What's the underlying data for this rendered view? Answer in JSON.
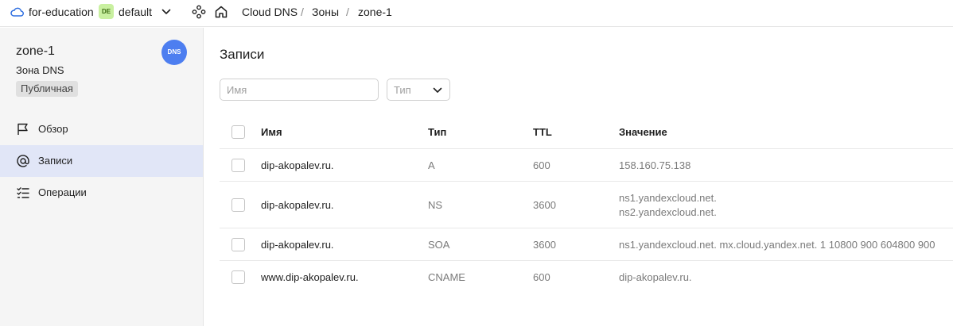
{
  "topbar": {
    "org": "for-education",
    "folder_badge": "DE",
    "folder": "default",
    "breadcrumbs": [
      "Cloud DNS",
      "Зоны",
      "zone-1"
    ],
    "separator": "/"
  },
  "sidebar": {
    "title": "zone-1",
    "subtitle": "Зона DNS",
    "badge": "Публичная",
    "avatar_text": "DNS",
    "items": [
      {
        "label": "Обзор",
        "icon": "flag-icon",
        "active": false
      },
      {
        "label": "Записи",
        "icon": "at-icon",
        "active": true
      },
      {
        "label": "Операции",
        "icon": "list-icon",
        "active": false
      }
    ]
  },
  "main": {
    "title": "Записи",
    "search_placeholder": "Имя",
    "type_placeholder": "Тип",
    "columns": [
      "Имя",
      "Тип",
      "TTL",
      "Значение"
    ],
    "rows": [
      {
        "name": "dip-akopalev.ru.",
        "type": "A",
        "ttl": "600",
        "value": [
          "158.160.75.138"
        ]
      },
      {
        "name": "dip-akopalev.ru.",
        "type": "NS",
        "ttl": "3600",
        "value": [
          "ns1.yandexcloud.net.",
          "ns2.yandexcloud.net."
        ]
      },
      {
        "name": "dip-akopalev.ru.",
        "type": "SOA",
        "ttl": "3600",
        "value": [
          "ns1.yandexcloud.net. mx.cloud.yandex.net. 1 10800 900 604800 900"
        ]
      },
      {
        "name": "www.dip-akopalev.ru.",
        "type": "CNAME",
        "ttl": "600",
        "value": [
          "dip-akopalev.ru."
        ]
      }
    ]
  },
  "colors": {
    "accent": "#4d7ef0",
    "active_nav": "#e1e6f7",
    "sidebar_bg": "#f5f5f5",
    "folder_badge": "#c9f0a0"
  }
}
